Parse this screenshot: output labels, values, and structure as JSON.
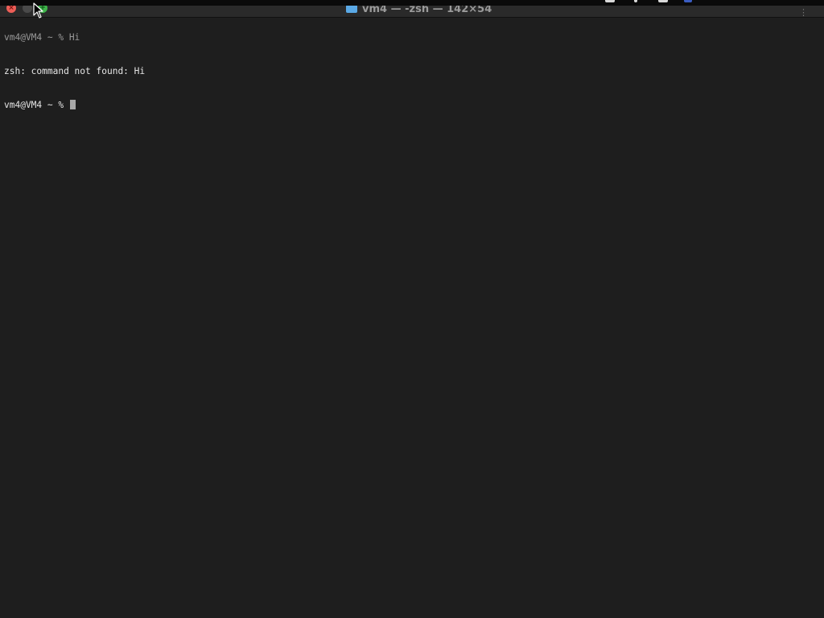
{
  "window": {
    "title": "vm4 — -zsh — 142×54",
    "folder_icon": "folder-icon"
  },
  "traffic_lights": {
    "close_glyph": "×",
    "zoom_glyph": "+",
    "colors": {
      "close": "#ed5e57",
      "minimize": "#4a4a4a",
      "zoom": "#3fb64b"
    }
  },
  "terminal": {
    "previous_command": "vm4@VM4 ~ % Hi",
    "output": "zsh: command not found: Hi",
    "prompt": "vm4@VM4 ~ % ",
    "background": "#1e1e1e",
    "foreground": "#e6e6e6"
  },
  "tab_overflow": "⋮"
}
